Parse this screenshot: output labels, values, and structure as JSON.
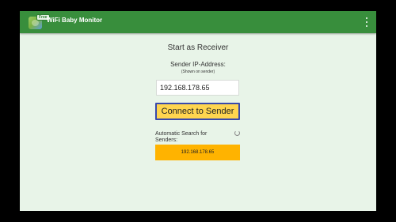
{
  "app_bar": {
    "title": "WiFi Baby Monitor",
    "badge": "Free",
    "icon": "app-logo-icon",
    "menu_icon": "overflow-menu-icon"
  },
  "main": {
    "heading": "Start as Receiver",
    "ip_label": "Sender IP-Address:",
    "ip_hint": "(Shown on sender)",
    "ip_value": "192.168.178.65",
    "connect_label": "Connect to Sender",
    "auto_search_label": "Automatic Search for Senders:",
    "spinner_icon": "loading-spinner-icon",
    "found_senders": [
      "192.168.178.65"
    ]
  },
  "colors": {
    "app_bar": "#388e3c",
    "background": "#e8f4e8",
    "connect_button": "#ffd54f",
    "connect_border": "#3949ab",
    "found_sender": "#ffb300"
  }
}
